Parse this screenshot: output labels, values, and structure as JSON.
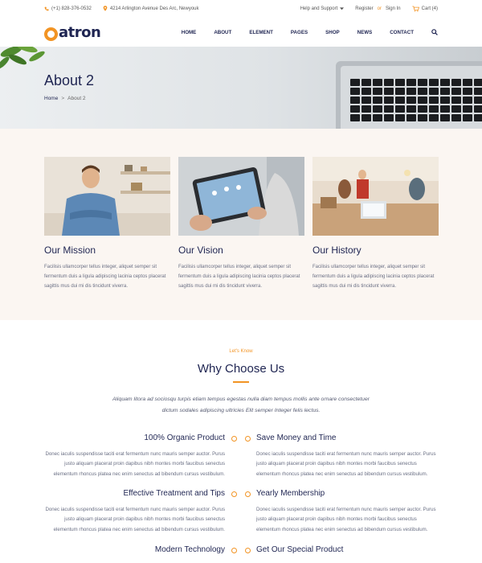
{
  "topbar": {
    "phone": "(+1) 828-376-0532",
    "address": "4214 Arlington Avenue Des Arc, Newyouk",
    "help": "Help and Support",
    "register": "Register",
    "or": "or",
    "signin": "Sign In",
    "cart": "Cart (4)"
  },
  "header": {
    "logo_text": "atron",
    "nav": [
      "HOME",
      "ABOUT",
      "ELEMENT",
      "PAGES",
      "SHOP",
      "NEWS",
      "CONTACT"
    ]
  },
  "hero": {
    "title": "About 2",
    "breadcrumb_home": "Home",
    "breadcrumb_sep": ">",
    "breadcrumb_current": "About 2"
  },
  "cards": [
    {
      "title": "Our Mission",
      "text": "Facilisis ullamcorper tellus integer, aliquet semper sit fermentum duis a ligula adipiscing lacinia ceptos placerat sagittis mus dui mi dis tincidunt viverra."
    },
    {
      "title": "Our Vision",
      "text": "Facilisis ullamcorper tellus integer, aliquet semper sit fermentum duis a ligula adipiscing lacinia ceptos placerat sagittis mus dui mi dis tincidunt viverra."
    },
    {
      "title": "Our History",
      "text": "Facilisis ullamcorper tellus integer, aliquet semper sit fermentum duis a ligula adipiscing lacinia ceptos placerat sagittis mus dui mi dis tincidunt viverra."
    }
  ],
  "why": {
    "kicker": "Let's Know",
    "title": "Why Choose Us",
    "intro": "Aliquam litora ad sociosqu turpis etiam tempus egestas nulla diam tempus mollis ante ornare consectetuer dictum sodales adipiscing ultricies Elit semper Integer felis lectus.",
    "features": [
      {
        "title": "100% Organic Product",
        "text": "Donec iaculis suspendisse taciti erat fermentum nunc mauris semper auctor. Purus justo aliquam placerat proin dapibus nibh montes morbi faucibus senectus elementum rhoncus platea nec enim senectus ad bibendum cursus vestibulum."
      },
      {
        "title": "Save Money and Time",
        "text": "Donec iaculis suspendisse taciti erat fermentum nunc mauris semper auctor. Purus justo aliquam placerat proin dapibus nibh montes morbi faucibus senectus elementum rhoncus platea nec enim senectus ad bibendum cursus vestibulum."
      },
      {
        "title": "Effective Treatment and Tips",
        "text": "Donec iaculis suspendisse taciti erat fermentum nunc mauris semper auctor. Purus justo aliquam placerat proin dapibus nibh montes morbi faucibus senectus elementum rhoncus platea nec enim senectus ad bibendum cursus vestibulum."
      },
      {
        "title": "Yearly Membership",
        "text": "Donec iaculis suspendisse taciti erat fermentum nunc mauris semper auctor. Purus justo aliquam placerat proin dapibus nibh montes morbi faucibus senectus elementum rhoncus platea nec enim senectus ad bibendum cursus vestibulum."
      },
      {
        "title": "Modern Technology",
        "text": ""
      },
      {
        "title": "Get Our Special Product",
        "text": ""
      }
    ]
  },
  "colors": {
    "accent": "#f29424",
    "navy": "#1f2552",
    "section_bg": "#fbf6f2"
  }
}
